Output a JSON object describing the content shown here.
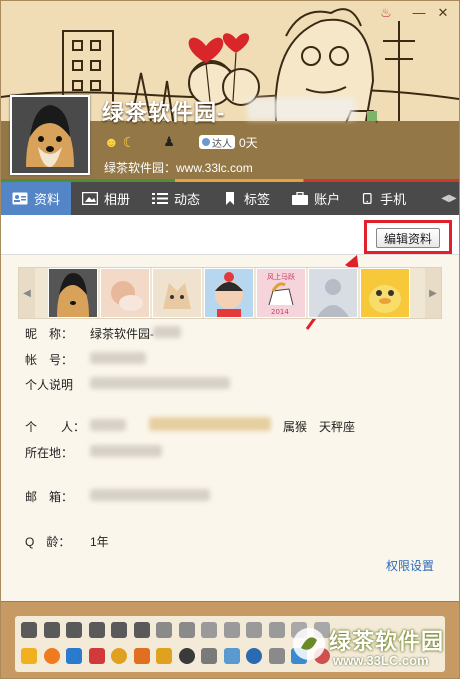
{
  "header": {
    "nickname": "绿茶软件园-",
    "days_text": "0天",
    "level_badge": "达人",
    "signature": "绿茶软件园：www.33lc.com"
  },
  "tabs": [
    {
      "label": "资料",
      "icon": "profile-card-icon",
      "active": true
    },
    {
      "label": "相册",
      "icon": "album-icon",
      "active": false
    },
    {
      "label": "动态",
      "icon": "feed-list-icon",
      "active": false
    },
    {
      "label": "标签",
      "icon": "bookmark-icon",
      "active": false
    },
    {
      "label": "账户",
      "icon": "briefcase-icon",
      "active": false
    },
    {
      "label": "手机",
      "icon": "phone-icon",
      "active": false
    }
  ],
  "edit_button": "编辑资料",
  "profile": {
    "nickname_label": "昵　称：",
    "nickname_value": "绿茶软件园-",
    "account_label": "帐　号：",
    "bio_label": "个人说明",
    "personal_label": "个　　人：",
    "zodiac_animal": "属猴",
    "constellation": "天秤座",
    "location_label": "所在地：",
    "email_label": "邮　箱：",
    "qage_label": "Q　龄：",
    "qage_value": "1年"
  },
  "permission_link": "权限设置",
  "watermark": {
    "line1": "绿茶软件园",
    "line2": "www.33LC.com"
  },
  "colors": {
    "tab_active": "#5486c7",
    "tab_bar": "#4a4a4a",
    "highlight": "#e0202a",
    "link": "#2d6bb8"
  }
}
